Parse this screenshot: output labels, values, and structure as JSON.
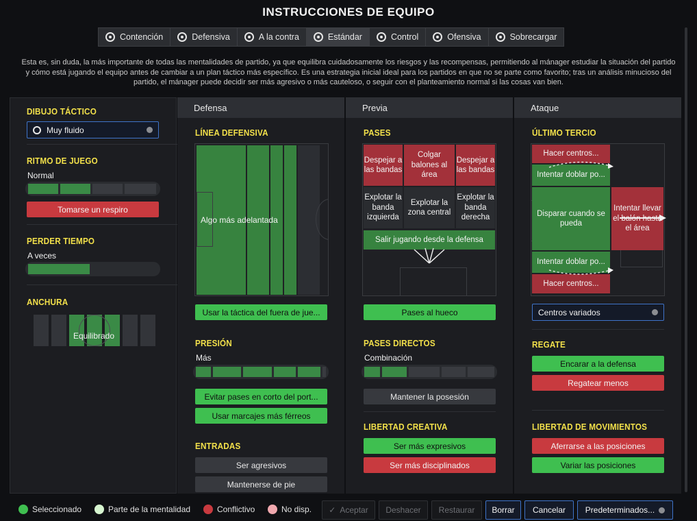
{
  "title": "INSTRUCCIONES DE EQUIPO",
  "tabs": [
    {
      "label": "Contención"
    },
    {
      "label": "Defensiva"
    },
    {
      "label": "A la contra"
    },
    {
      "label": "Estándar"
    },
    {
      "label": "Control"
    },
    {
      "label": "Ofensiva"
    },
    {
      "label": "Sobrecargar"
    }
  ],
  "description": "Esta es, sin duda, la más importante de todas las mentalidades de partido, ya que equilibra cuidadosamente los riesgos y las recompensas, permitiendo al mánager estudiar la situación del partido y cómo está jugando el equipo antes de cambiar a un plan táctico más específico. Es una estrategia inicial ideal para los partidos en que no se parte como favorito; tras un análisis minucioso del partido, el mánager puede decidir ser más agresivo o más cauteloso, o seguir con el planteamiento normal si las cosas van bien.",
  "left": {
    "dibujo": {
      "title": "DIBUJO TÁCTICO",
      "value": "Muy fluido"
    },
    "ritmo": {
      "title": "RITMO DE JUEGO",
      "value": "Normal",
      "level": 0.5,
      "button": "Tomarse un respiro"
    },
    "perder": {
      "title": "PERDER TIEMPO",
      "value": "A veces",
      "level": 0.45
    },
    "anchura": {
      "title": "ANCHURA",
      "value": "Equilibrado"
    }
  },
  "columns": {
    "defensa": {
      "header": "Defensa",
      "linea": {
        "title": "LÍNEA DEFENSIVA",
        "value": "Algo más adelantada",
        "button": "Usar la táctica del fuera de jue..."
      },
      "presion": {
        "title": "PRESIÓN",
        "value": "Más",
        "level": 0.85,
        "buttons": [
          "Evitar pases en corto del port...",
          "Usar marcajes más férreos"
        ]
      },
      "entradas": {
        "title": "ENTRADAS",
        "buttons": [
          "Ser agresivos",
          "Mantenerse de pie"
        ]
      }
    },
    "previa": {
      "header": "Previa",
      "pases": {
        "title": "PASES",
        "cells": [
          "Despejar a las bandas",
          "Colgar balones al área",
          "Despejar a las bandas",
          "Explotar la banda izquierda",
          "Explotar la zona central",
          "Explotar la banda derecha",
          "Salir jugando desde la defensa"
        ],
        "button": "Pases al hueco"
      },
      "directos": {
        "title": "PASES DIRECTOS",
        "value": "Combinación",
        "level": 0.4,
        "button": "Mantener la posesión"
      },
      "libertad": {
        "title": "LIBERTAD CREATIVA",
        "buttons": [
          "Ser más expresivos",
          "Ser más disciplinados"
        ]
      }
    },
    "ataque": {
      "header": "Ataque",
      "tercio": {
        "title": "ÚLTIMO TERCIO",
        "cells": [
          "Hacer centros...",
          "Intentar doblar po...",
          "Disparar cuando se pueda",
          "Intentar llevar el balón hasta el área",
          "Intentar doblar po...",
          "Hacer centros..."
        ],
        "select": "Centros variados"
      },
      "regate": {
        "title": "REGATE",
        "buttons": [
          "Encarar a la defensa",
          "Regatear menos"
        ]
      },
      "movimientos": {
        "title": "LIBERTAD DE MOVIMIENTOS",
        "buttons": [
          "Aferrarse a las posiciones",
          "Variar las posiciones"
        ]
      }
    }
  },
  "legend": [
    {
      "label": "Seleccionado",
      "color": "#3fbf50"
    },
    {
      "label": "Parte de la mentalidad",
      "color": "#d6f5cf"
    },
    {
      "label": "Conflictivo",
      "color": "#c83a3f"
    },
    {
      "label": "No disp.",
      "color": "#f0a8ae"
    }
  ],
  "actions": {
    "accept": "Aceptar",
    "undo": "Deshacer",
    "restore": "Restaurar",
    "clear": "Borrar",
    "cancel": "Cancelar",
    "defaults": "Predeterminados..."
  }
}
